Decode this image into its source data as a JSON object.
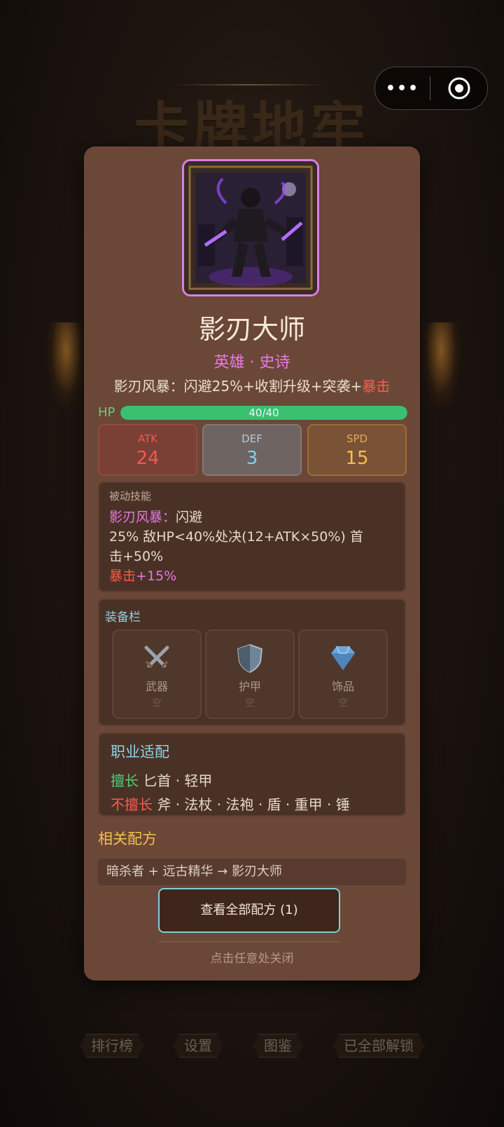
{
  "background": {
    "game_title": "卡牌地牢"
  },
  "capsule": {
    "more_icon": "more-dots-icon",
    "close_icon": "target-circle-icon"
  },
  "card": {
    "name": "影刃大师",
    "rarity": "英雄 · 史诗",
    "skill_summary_prefix": "影刃风暴：闪避25%+收割升级+突袭+",
    "skill_summary_crit": "暴击",
    "hp": {
      "label": "HP",
      "current": 40,
      "max": 40,
      "text": "40/40"
    },
    "stats": [
      {
        "label": "ATK",
        "value": "24"
      },
      {
        "label": "DEF",
        "value": "3"
      },
      {
        "label": "SPD",
        "value": "15"
      }
    ],
    "passive": {
      "title": "被动技能",
      "name": "影刃风暴：",
      "name_suffix": "闪避",
      "line2": "25% 敌HP<40%处决(12+ATK×50%) 首",
      "line3": "击+50%",
      "crit_label": "暴击",
      "crit_value": "+15%"
    },
    "equipment": {
      "title": "装备栏",
      "slots": [
        {
          "name": "武器",
          "state": "空",
          "icon": "crossed-swords-icon"
        },
        {
          "name": "护甲",
          "state": "空",
          "icon": "shield-icon"
        },
        {
          "name": "饰品",
          "state": "空",
          "icon": "diamond-icon"
        }
      ]
    },
    "class_fit": {
      "title": "职业适配",
      "good_label": "擅长",
      "good_items": "匕首 · 轻甲",
      "bad_label": "不擅长",
      "bad_items": "斧 · 法杖 · 法袍 · 盾 · 重甲 · 锤"
    },
    "recipes": {
      "title": "相关配方",
      "items": [
        "暗杀者 + 远古精华 → 影刃大师"
      ],
      "view_all_label": "查看全部配方 (1)"
    },
    "close_hint": "点击任意处关闭"
  },
  "bottom_nav": [
    "排行榜",
    "设置",
    "图鉴",
    "已全部解锁"
  ],
  "colors": {
    "modal_bg": "#6b4738",
    "rarity": "#e77be0",
    "hp": "#39c071",
    "atk": "#ef5a4e",
    "def": "#7ad2f2",
    "spd": "#f6bf4a",
    "accent_cyan": "#8fd1e6",
    "recipe_gold": "#f2c14e"
  }
}
